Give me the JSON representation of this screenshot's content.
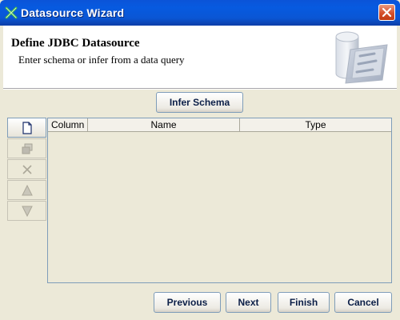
{
  "window": {
    "title": "Datasource Wizard"
  },
  "header": {
    "title": "Define JDBC Datasource",
    "subtitle": "Enter schema or infer from a data query"
  },
  "infer_button": "Infer Schema",
  "toolbar": {
    "items": [
      {
        "icon": "new-document-icon",
        "enabled": true
      },
      {
        "icon": "copy-icon",
        "enabled": false
      },
      {
        "icon": "delete-icon",
        "enabled": false
      },
      {
        "icon": "move-up-icon",
        "enabled": false
      },
      {
        "icon": "move-down-icon",
        "enabled": false
      }
    ]
  },
  "table": {
    "columns": [
      "Column",
      "Name",
      "Type"
    ],
    "rows": []
  },
  "footer": {
    "previous": "Previous",
    "next": "Next",
    "finish": "Finish",
    "cancel": "Cancel"
  },
  "colors": {
    "titlebar": "#0b54d8",
    "close": "#d5502c",
    "dialog_bg": "#ece9d8"
  }
}
